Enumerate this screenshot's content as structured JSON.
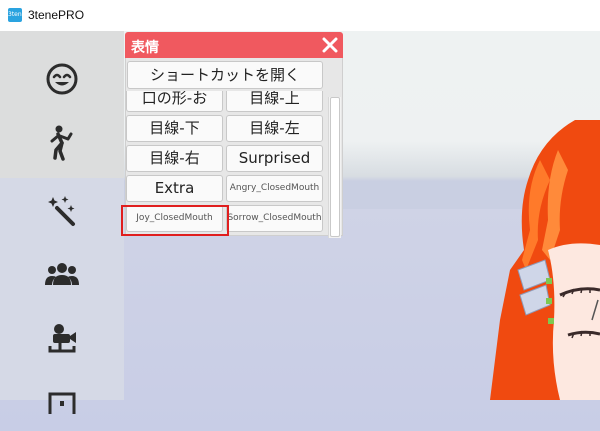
{
  "window": {
    "title": "3tenePRO",
    "icon_text": "3tene"
  },
  "sidebar": {
    "items": [
      {
        "icon": "smiley-face-icon"
      },
      {
        "icon": "pose-figure-icon"
      },
      {
        "icon": "magic-wand-icon"
      },
      {
        "icon": "group-people-icon"
      },
      {
        "icon": "webcam-tracking-icon"
      },
      {
        "icon": "frame-icon"
      }
    ]
  },
  "panel": {
    "title": "表情",
    "close_icon": "close-icon",
    "shortcut_button": "ショートカットを開く",
    "buttons": [
      "口の形-お",
      "目線-上",
      "目線-下",
      "目線-左",
      "目線-右",
      "Surprised",
      "Extra",
      "Angry_ClosedMouth",
      "Joy_ClosedMouth",
      "Sorrow_ClosedMouth"
    ]
  },
  "colors": {
    "panel_header": "#f0595f",
    "highlight": "#e01e1e",
    "character_hair": "#f04a10"
  }
}
